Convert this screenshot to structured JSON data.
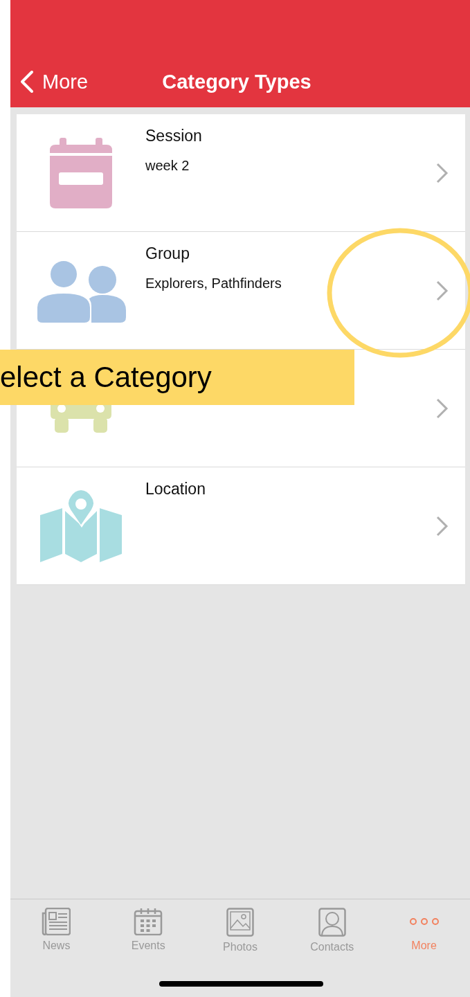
{
  "nav_bar": {
    "back_label": "More",
    "title": "Category Types"
  },
  "categories": [
    {
      "kind": "calendar",
      "color": "#e1aec6",
      "title": "Session",
      "subtitle": "week 2"
    },
    {
      "kind": "group",
      "color": "#a9c4e3",
      "title": "Group",
      "subtitle": "Explorers, Pathfinders"
    },
    {
      "kind": "bus",
      "color": "#dbe2ab"
    },
    {
      "kind": "map",
      "color": "#a8dde1",
      "title": "Location"
    }
  ],
  "callout": {
    "text": "elect a Category"
  },
  "tab_bar": [
    {
      "kind": "news",
      "label": "News",
      "selected": false
    },
    {
      "kind": "events",
      "label": "Events",
      "selected": false
    },
    {
      "kind": "photos",
      "label": "Photos",
      "selected": false
    },
    {
      "kind": "contacts",
      "label": "Contacts",
      "selected": false
    },
    {
      "kind": "more",
      "label": "More",
      "selected": true
    }
  ]
}
